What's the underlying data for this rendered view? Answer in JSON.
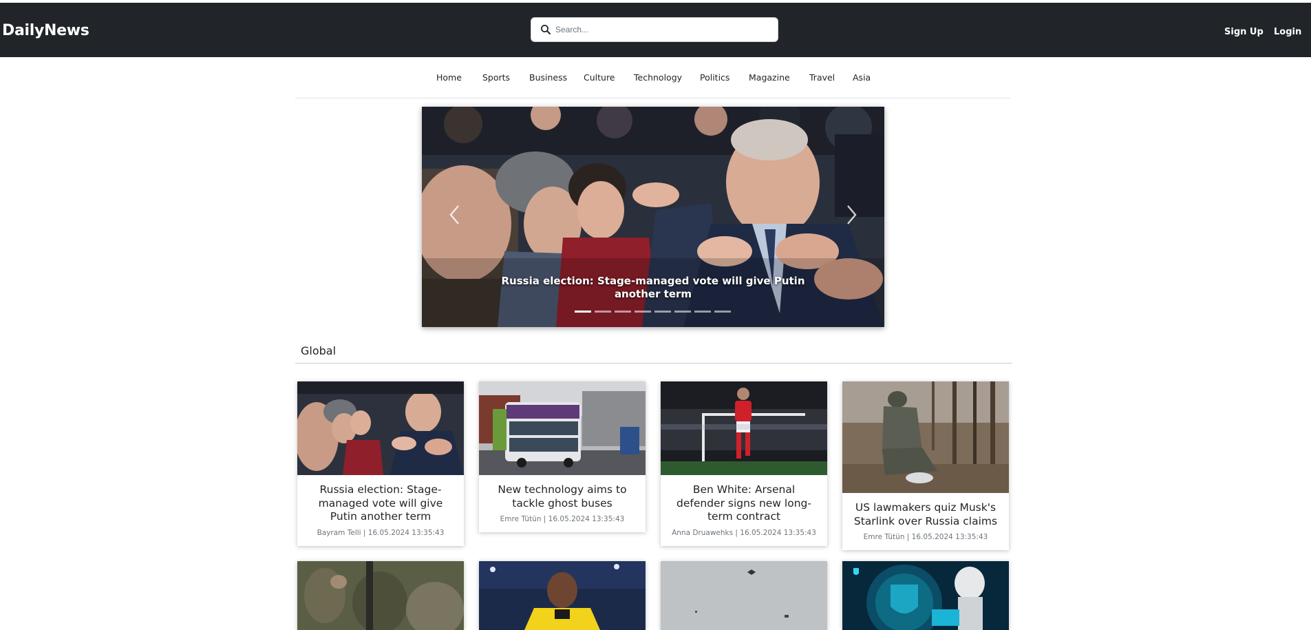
{
  "header": {
    "brand": "DailyNews",
    "search_placeholder": "Search...",
    "signup_label": "Sign Up",
    "login_label": "Login",
    "colors": {
      "bar": "#212529",
      "text": "#ffffff"
    }
  },
  "nav": {
    "items": [
      {
        "label": "Home"
      },
      {
        "label": "Sports"
      },
      {
        "label": "Business"
      },
      {
        "label": "Culture"
      },
      {
        "label": "Technology"
      },
      {
        "label": "Politics"
      },
      {
        "label": "Magazine"
      },
      {
        "label": "Travel"
      },
      {
        "label": "Asia"
      }
    ]
  },
  "hero": {
    "caption": "Russia election: Stage-managed vote will give Putin another term",
    "slide_count": 8,
    "active_slide": 1,
    "prev_icon": "chevron-left-icon",
    "next_icon": "chevron-right-icon"
  },
  "section": {
    "title": "Global"
  },
  "cards": [
    {
      "title": "Russia election: Stage-managed vote will give Putin another term",
      "meta": "Bayram Telli | 16.05.2024 13:35:43"
    },
    {
      "title": "New technology aims to tackle ghost buses",
      "meta": "Emre Tütün | 16.05.2024 13:35:43"
    },
    {
      "title": "Ben White: Arsenal defender signs new long-term contract",
      "meta": "Anna Druawehks | 16.05.2024 13:35:43"
    },
    {
      "title": "US lawmakers quiz Musk's Starlink over Russia claims",
      "meta": "Emre Tütün | 16.05.2024 13:35:43"
    }
  ],
  "icons": {
    "search": "search-icon"
  }
}
